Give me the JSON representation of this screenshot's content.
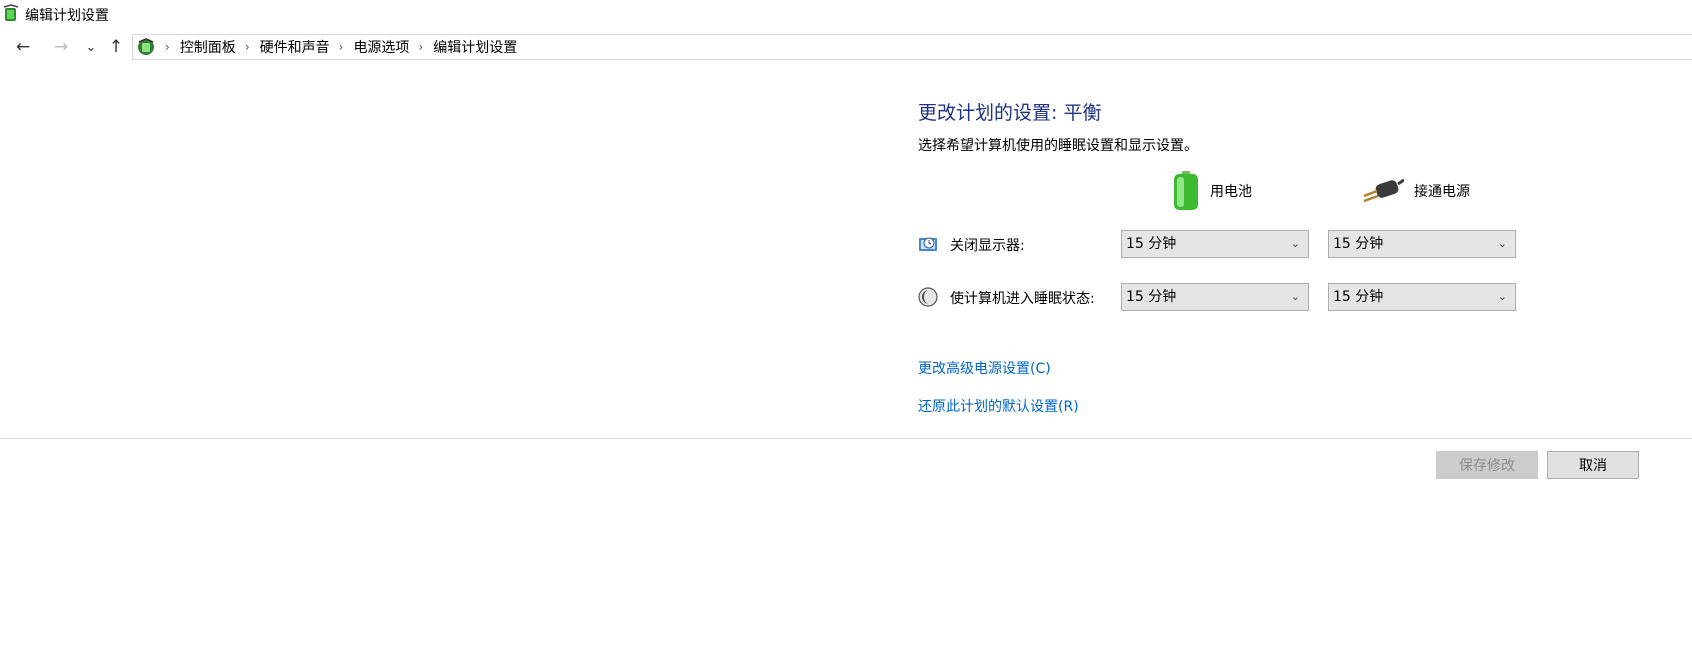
{
  "window": {
    "title": "编辑计划设置"
  },
  "nav": {
    "back_icon": "←",
    "forward_icon": "→",
    "recent_icon": "⌄",
    "up_icon": "↑",
    "breadcrumbs": [
      "控制面板",
      "硬件和声音",
      "电源选项",
      "编辑计划设置"
    ],
    "separator": "›"
  },
  "main": {
    "heading": "更改计划的设置: 平衡",
    "subheading": "选择希望计算机使用的睡眠设置和显示设置。",
    "columns": {
      "battery": "用电池",
      "plugged_in": "接通电源"
    },
    "settings": [
      {
        "label": "关闭显示器:",
        "icon": "monitor-clock-icon",
        "battery": "15 分钟",
        "plugged_in": "15 分钟"
      },
      {
        "label": "使计算机进入睡眠状态:",
        "icon": "moon-icon",
        "battery": "15 分钟",
        "plugged_in": "15 分钟"
      }
    ],
    "links": {
      "advanced": "更改高级电源设置(C)",
      "restore": "还原此计划的默认设置(R)"
    }
  },
  "footer": {
    "save": "保存修改",
    "cancel": "取消"
  },
  "colors": {
    "heading": "#1e3287",
    "link": "#0066cc",
    "battery_green": "#3dbb2f"
  }
}
